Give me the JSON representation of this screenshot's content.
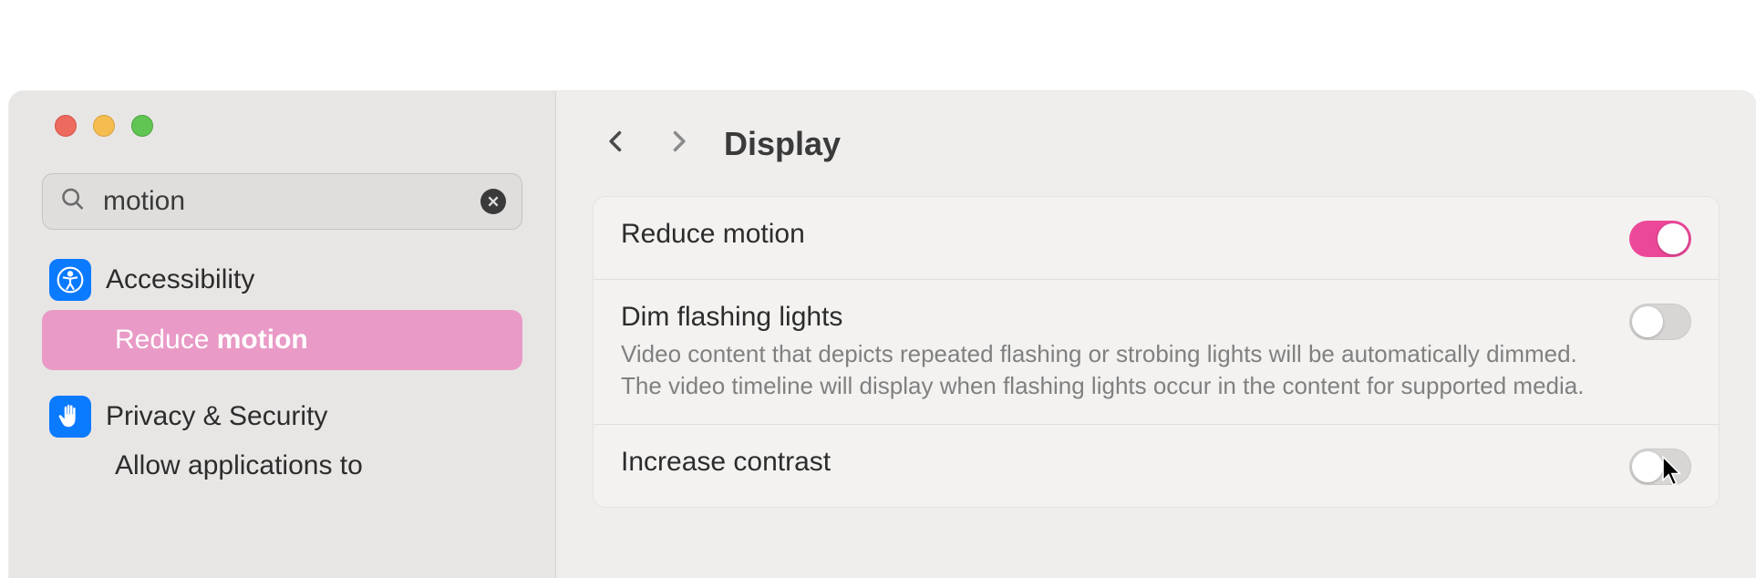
{
  "search": {
    "value": "motion"
  },
  "sidebar": {
    "groups": [
      {
        "icon": "accessibility-icon",
        "label": "Accessibility",
        "items": [
          {
            "prefix": "Reduce ",
            "match": "motion"
          }
        ]
      },
      {
        "icon": "privacy-icon",
        "label": "Privacy & Security",
        "truncated": "Allow applications to"
      }
    ]
  },
  "header": {
    "title": "Display"
  },
  "settings": [
    {
      "title": "Reduce motion",
      "desc": "",
      "on": true
    },
    {
      "title": "Dim flashing lights",
      "desc": "Video content that depicts repeated flashing or strobing lights will be automatically dimmed. The video timeline will display when flashing lights occur in the content for supported media.",
      "on": false
    },
    {
      "title": "Increase contrast",
      "desc": "",
      "on": false
    }
  ]
}
